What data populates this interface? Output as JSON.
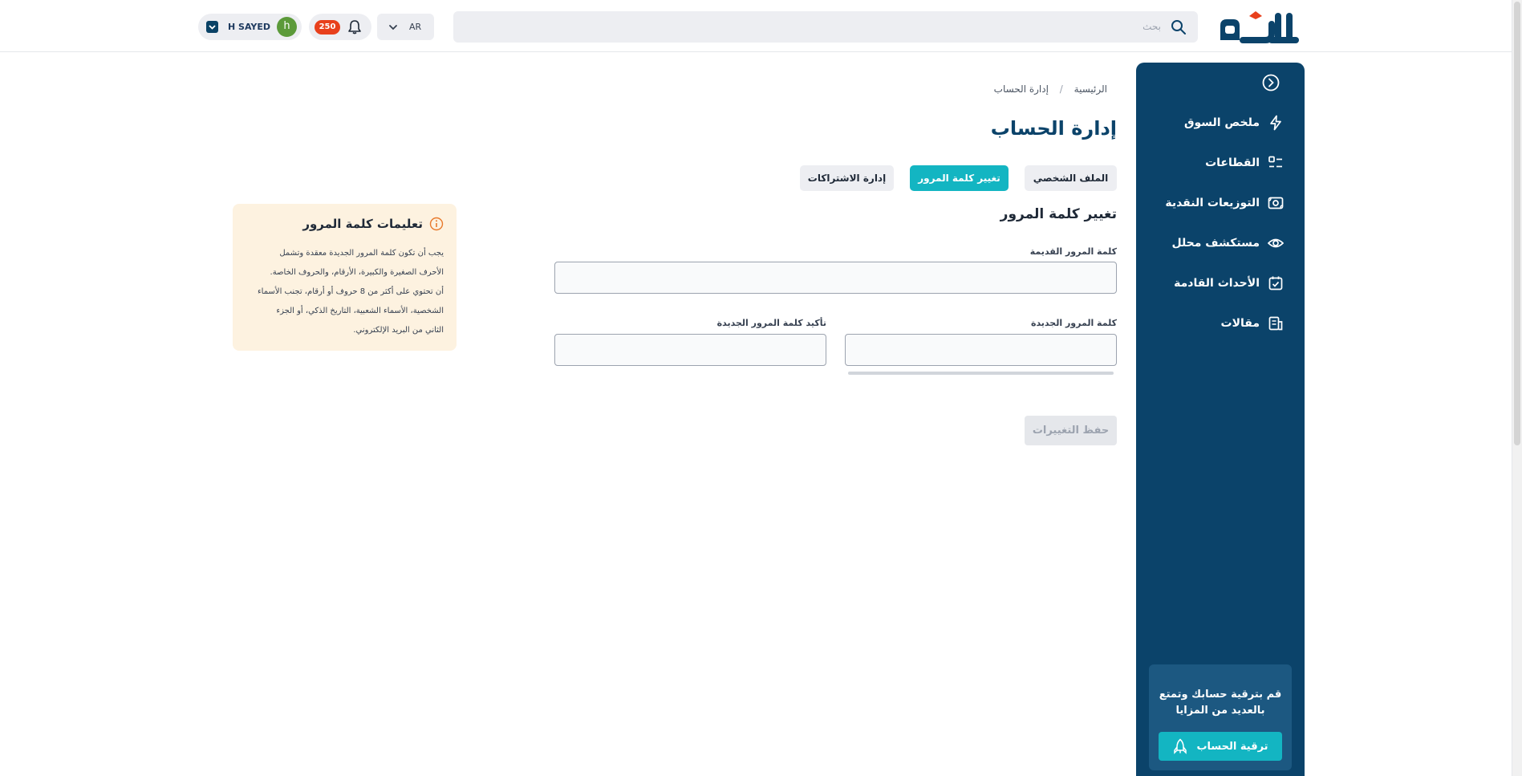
{
  "header": {
    "logo_text": "محلل",
    "search_placeholder": "بحث",
    "language": "AR",
    "notifications_count": "250",
    "user": {
      "name": "H SAYED",
      "initial": "h"
    }
  },
  "sidebar": {
    "items": [
      {
        "label": "ملخص السوق",
        "icon": "lightning-icon"
      },
      {
        "label": "القطاعات",
        "icon": "list-icon"
      },
      {
        "label": "التوزيعات النقدية",
        "icon": "cash-icon"
      },
      {
        "label": "مستكشف محلل",
        "icon": "eye-icon"
      },
      {
        "label": "الأحداث القادمة",
        "icon": "calendar-check-icon"
      },
      {
        "label": "مقالات",
        "icon": "article-icon"
      }
    ],
    "upgrade": {
      "text": "قم بترقية حسابك وتمتع بالعديد من المزايا",
      "button_label": "ترقية الحساب"
    }
  },
  "breadcrumb": {
    "home": "الرئيسية",
    "separator": "/",
    "current": "إدارة الحساب"
  },
  "page_title": "إدارة الحساب",
  "tabs": [
    {
      "label": "الملف الشخصي",
      "active": false
    },
    {
      "label": "تغيير كلمة المرور",
      "active": true
    },
    {
      "label": "إدارة الاشتراكات",
      "active": false
    }
  ],
  "form": {
    "section_title": "تغيير كلمة المرور",
    "old_password_label": "كلمة المرور القديمة",
    "new_password_label": "كلمة المرور الجديدة",
    "confirm_password_label": "تأكيد كلمة المرور الجديدة",
    "old_password_value": "",
    "new_password_value": "",
    "confirm_password_value": "",
    "save_label": "حفظ التغييرات"
  },
  "instructions": {
    "title": "تعليمات كلمة المرور",
    "lines": [
      "يجب أن تكون كلمة المرور الجديدة معقدة وتشمل",
      "الأحرف الصغيرة والكبيرة، الأرقام، والحروف الخاصة.",
      "أن تحتوي على أكثر من 8 حروف أو أرقام، تجنب الأسماء",
      "الشخصية، الأسماء الشعبية، التاريخ الذكي، أو الجزء",
      "الثاني من البريد الإلكتروني."
    ]
  },
  "colors": {
    "brand_navy": "#0b436a",
    "accent_teal": "#13b5c2",
    "badge_red": "#e8401c",
    "info_bg": "#fdf2e0",
    "info_icon": "#e8792b"
  }
}
